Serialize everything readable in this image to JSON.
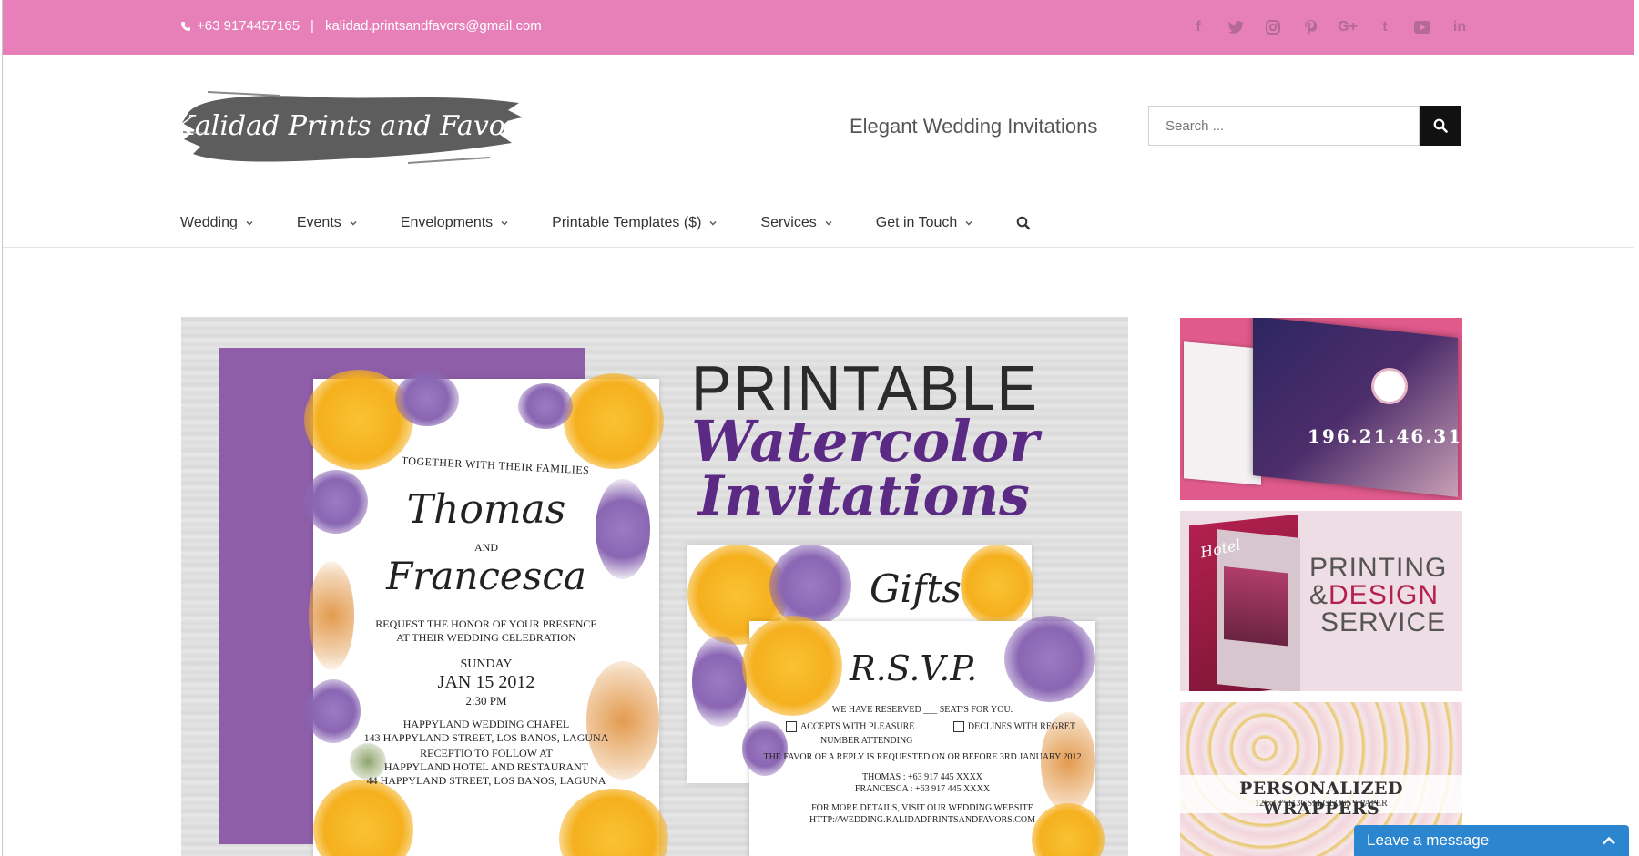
{
  "topbar": {
    "phone": "+63 9174457165",
    "separator": "|",
    "email": "kalidad.printsandfavors@gmail.com",
    "bg_color": "#e77fb9",
    "social_icons": [
      "facebook-icon",
      "twitter-icon",
      "instagram-icon",
      "pinterest-icon",
      "google-plus-icon",
      "tumblr-icon",
      "youtube-icon",
      "linkedin-icon"
    ],
    "social_glyphs": [
      "f",
      "t",
      "◎",
      "p",
      "G+",
      "t",
      "▶",
      "in"
    ]
  },
  "header": {
    "logo_text": "Kalidad Prints and Favors",
    "tagline": "Elegant Wedding Invitations",
    "search_placeholder": "Search ..."
  },
  "nav": {
    "items": [
      {
        "label": "Wedding"
      },
      {
        "label": "Events"
      },
      {
        "label": "Envelopments"
      },
      {
        "label": "Printable Templates ($)"
      },
      {
        "label": "Services"
      },
      {
        "label": "Get in Touch"
      }
    ]
  },
  "banner": {
    "title_line1": "PRINTABLE",
    "title_line2": "Watercolor",
    "title_line3": "Invitations",
    "invite": {
      "together": "TOGETHER WITH THEIR FAMILIES",
      "name1": "Thomas",
      "and": "AND",
      "name2": "Francesca",
      "request1": "REQUEST THE HONOR OF YOUR PRESENCE",
      "request2": "AT THEIR WEDDING CELEBRATION",
      "day": "SUNDAY",
      "date": "JAN 15 2012",
      "time": "2:30 PM",
      "venue1": "HAPPYLAND WEDDING CHAPEL",
      "venue2": "143 HAPPYLAND STREET, LOS BANOS, LAGUNA",
      "recep1": "RECEPTIO TO FOLLOW AT",
      "recep2": "HAPPYLAND HOTEL AND RESTAURANT",
      "recep3": "44 HAPPYLAND STREET, LOS BANOS, LAGUNA"
    },
    "gifts_title": "Gifts",
    "rsvp": {
      "title": "R.S.V.P.",
      "reserved": "WE HAVE RESERVED ___ SEAT/S FOR YOU.",
      "accepts": "ACCEPTS WITH PLEASURE",
      "declines": "DECLINES WITH REGRET",
      "number": "NUMBER ATTENDING",
      "favor": "THE FAVOR OF A REPLY IS REQUESTED ON OR BEFORE 3RD JANUARY 2012",
      "thomas": "THOMAS : +63 917 445 XXXX",
      "francesca": "FRANCESCA : +63 917 445 XXXX",
      "details": "FOR MORE DETAILS, VISIT OUR WEDDING WEBSITE",
      "url": "HTTP://WEDDING.KALIDADPRINTSANDFAVORS.COM"
    }
  },
  "sidebar": {
    "ad1_ip": "196.21.46.31",
    "ad2_hotel": "Hotel",
    "ad2_line1": "PRINTING",
    "ad2_amp": "&",
    "ad2_design": "DESIGN",
    "ad2_line3": "SERVICE",
    "ad3_title": "PERSONALIZED WRAPPERS",
    "ad3_sub": "12\"x18\" 113GSM GLOSSY PAPER"
  },
  "chat": {
    "label": "Leave a message",
    "color": "#2b86cf"
  }
}
